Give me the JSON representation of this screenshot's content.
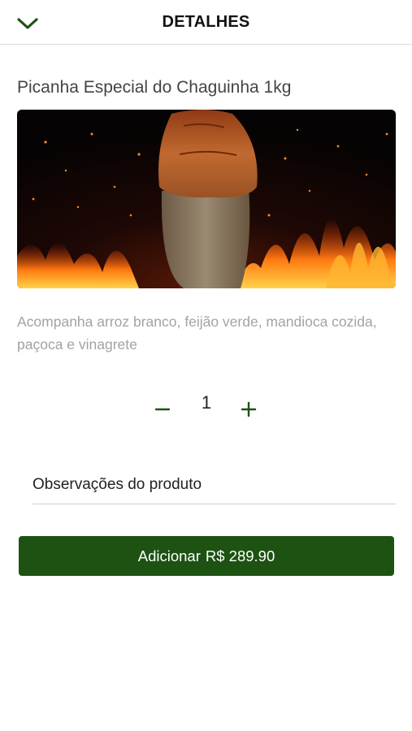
{
  "header": {
    "title": "DETALHES",
    "back_icon": "chevron-down-icon"
  },
  "product": {
    "name": "Picanha Especial do Chaguinha 1kg",
    "description": "Acompanha arroz branco, feijão verde, mandioca cozida, paçoca e vinagrete"
  },
  "quantity": {
    "minus_icon": "minus-icon",
    "value": "1",
    "plus_icon": "plus-icon"
  },
  "observations": {
    "placeholder": "Observações do produto",
    "value": ""
  },
  "add_button": {
    "label": "Adicionar",
    "price": "R$ 289.90"
  },
  "colors": {
    "primary_green": "#1d5213",
    "description_gray": "#a3a3a3"
  }
}
